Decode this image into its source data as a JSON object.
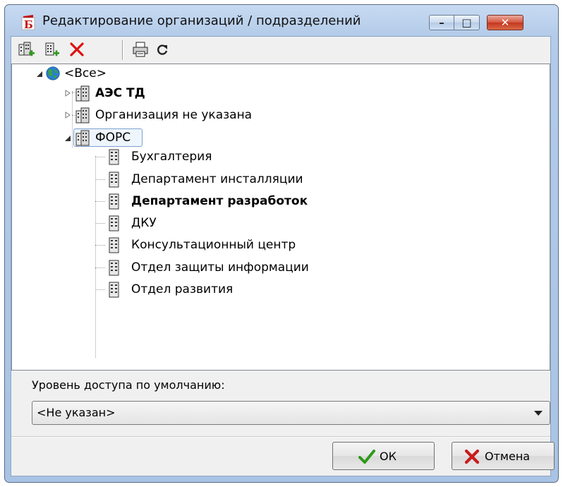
{
  "window": {
    "title": "Редактирование организаций / подразделений",
    "controls": {
      "minimize": "–",
      "maximize": "□",
      "close": "✕"
    }
  },
  "toolbar": {
    "items": [
      {
        "icon": "add-organization-icon"
      },
      {
        "icon": "add-department-icon"
      },
      {
        "icon": "delete-icon"
      },
      {
        "icon": "print-icon"
      },
      {
        "icon": "refresh-icon"
      }
    ]
  },
  "tree": {
    "root": {
      "label": "<Все>",
      "icon": "globe-icon",
      "expanded": true
    },
    "organizations": [
      {
        "label": "АЭС ТД",
        "bold": true,
        "expanded": false
      },
      {
        "label": "Организация не указана",
        "bold": false,
        "expanded": false
      },
      {
        "label": "ФОРС",
        "bold": false,
        "expanded": true,
        "selected": true
      }
    ],
    "departments": [
      {
        "label": "Бухгалтерия",
        "bold": false
      },
      {
        "label": "Департамент инсталляции",
        "bold": false
      },
      {
        "label": "Департамент разработок",
        "bold": true
      },
      {
        "label": "ДКУ",
        "bold": false
      },
      {
        "label": "Консультационный центр",
        "bold": false
      },
      {
        "label": "Отдел защиты информации",
        "bold": false
      },
      {
        "label": "Отдел развития",
        "bold": false
      }
    ]
  },
  "access": {
    "label": "Уровень доступа по умолчанию:",
    "selected": "<Не указан>"
  },
  "buttons": {
    "ok": "ОК",
    "cancel": "Отмена"
  },
  "colors": {
    "title_gradient_top": "#c7daf2",
    "close_red": "#c4361e",
    "selection_border": "#7da2ce",
    "ok_check_green": "#2f9a1a",
    "cancel_x_red": "#c81c1c"
  }
}
